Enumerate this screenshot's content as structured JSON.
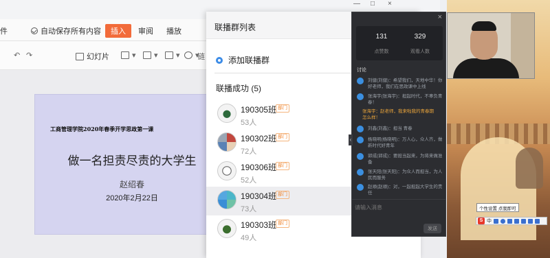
{
  "ppt": {
    "menubar": {
      "left_fragment": "件",
      "autosave": "自动保存所有内容",
      "insert": "插入",
      "review": "审阅",
      "slideshow": "播放"
    },
    "toolbar": {
      "undo": "↶",
      "redo": "↷",
      "slide_button": "幻灯片",
      "right_fragment": "链"
    },
    "slide": {
      "header": "工商管理学院2020年春季开学思政第一课",
      "title": "做一名担责尽责的大学生",
      "author": "赵绍春",
      "date": "2020年2月22日"
    }
  },
  "group_panel": {
    "title": "联播群列表",
    "add_label": "添加联播群",
    "success_heading": "联播成功 (5)",
    "groups": [
      {
        "name": "190305班",
        "badge": "部门",
        "count": "53人"
      },
      {
        "name": "190302班",
        "badge": "部门",
        "count": "72人"
      },
      {
        "name": "190306班",
        "badge": "部门",
        "count": "52人"
      },
      {
        "name": "190304班",
        "badge": "部门",
        "count": "73人"
      },
      {
        "name": "190303班",
        "badge": "部门",
        "count": "49人"
      }
    ]
  },
  "chat": {
    "close": "×",
    "stats": [
      {
        "value": "131",
        "label": "点赞数"
      },
      {
        "value": "329",
        "label": "观看人数"
      }
    ],
    "section": "讨论",
    "messages": [
      "刘健(刘健)：希望我们，天地中华！你好老师，我们在思政课中上线",
      "张海宇(张海宇)：担起时代，不辜负青春！",
      "张海宇：赵老师，我来啦我的青春期怎么样！",
      "刘鑫(刘鑫)：担当 青春",
      "杨晓明(杨晓明)：万人心，众人齐，做新时代好青年",
      "郭成(郭成)：要担当起来，为将来做准备",
      "张天阳(张天阳)：为众人而担当，为人民而服务",
      "赵顺(赵顺)：对，一起担起大学生的责任"
    ],
    "input_placeholder": "请输入消息",
    "send": "发送"
  },
  "window_controls": {
    "minimize": "—",
    "maximize": "□",
    "close": "×"
  },
  "tooltip": "个性设置 点我即可",
  "ime": {
    "logo": "S",
    "mode": "中"
  },
  "colors": {
    "accent_orange": "#f26b3a",
    "badge_orange": "#f0862f",
    "link_blue": "#3c8ce7",
    "chat_bg": "#2c2d31"
  }
}
